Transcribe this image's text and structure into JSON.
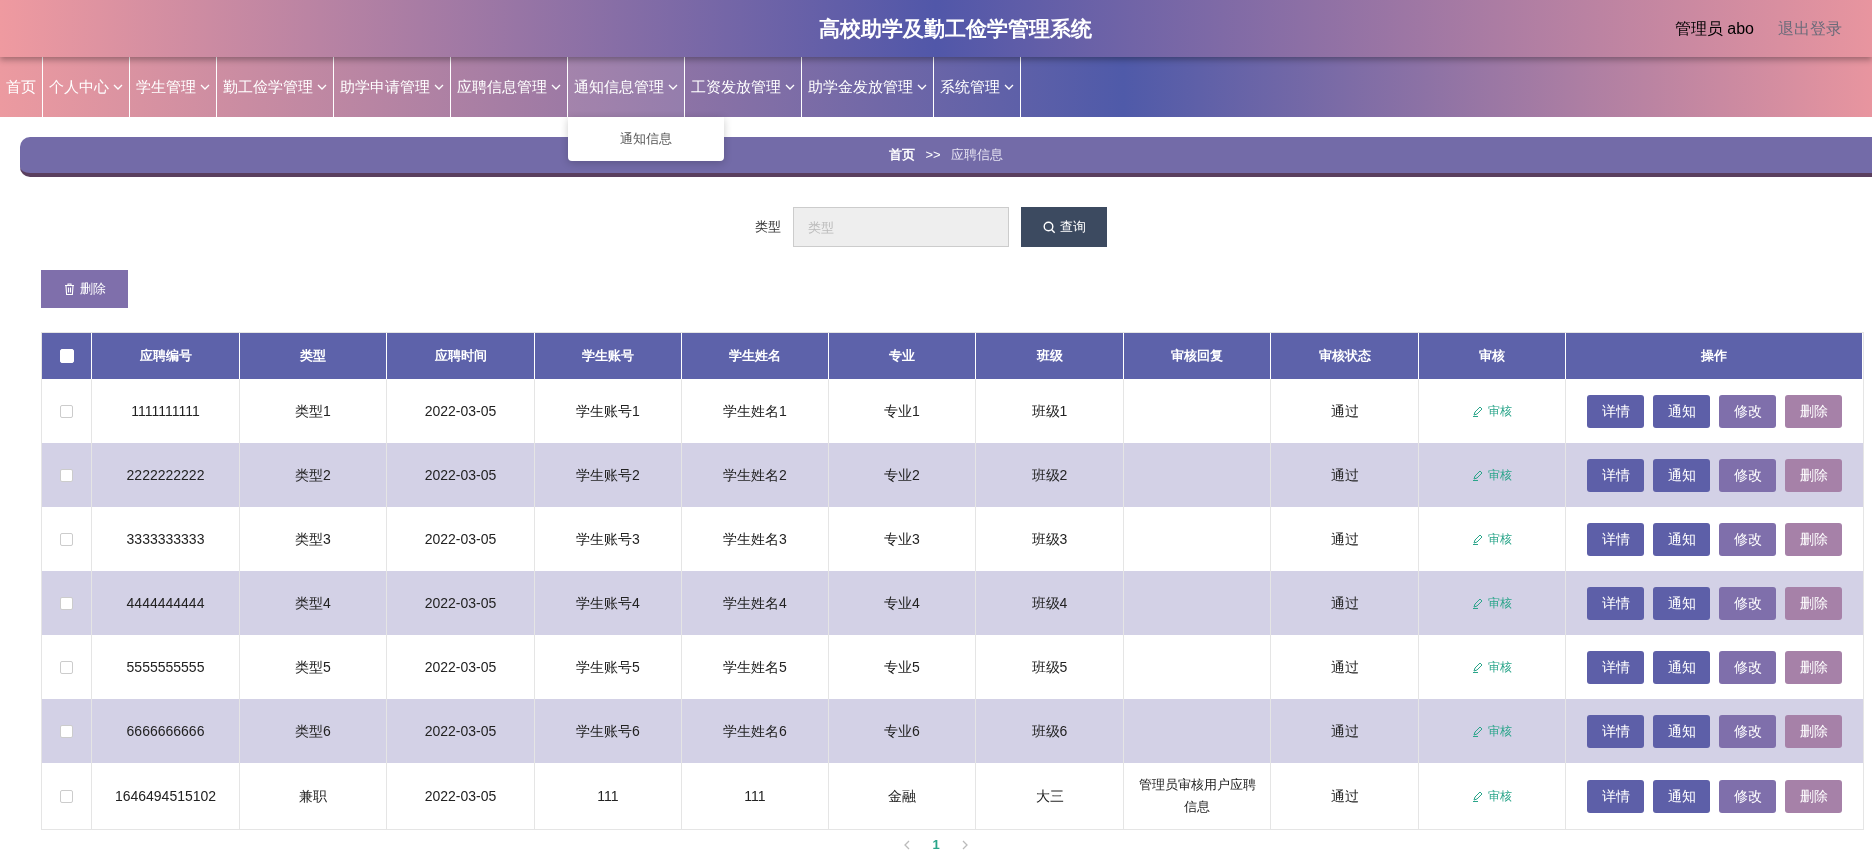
{
  "header": {
    "title": "高校助学及勤工俭学管理系统",
    "user_label": "管理员 abo",
    "logout": "退出登录"
  },
  "nav": [
    {
      "label": "首页",
      "caret": false,
      "expanded": false
    },
    {
      "label": "个人中心",
      "caret": true,
      "expanded": false
    },
    {
      "label": "学生管理",
      "caret": true,
      "expanded": false
    },
    {
      "label": "勤工俭学管理",
      "caret": true,
      "expanded": false
    },
    {
      "label": "助学申请管理",
      "caret": true,
      "expanded": false
    },
    {
      "label": "应聘信息管理",
      "caret": true,
      "expanded": false
    },
    {
      "label": "通知信息管理",
      "caret": true,
      "expanded": true,
      "dropdown": [
        "通知信息"
      ]
    },
    {
      "label": "工资发放管理",
      "caret": true,
      "expanded": false
    },
    {
      "label": "助学金发放管理",
      "caret": true,
      "expanded": false
    },
    {
      "label": "系统管理",
      "caret": true,
      "expanded": false
    }
  ],
  "breadcrumb": {
    "home": "首页",
    "separator": ">>",
    "current": "应聘信息"
  },
  "search": {
    "label": "类型",
    "placeholder": "类型",
    "button": "查询"
  },
  "delete_button": "删除",
  "table": {
    "select_all": {
      "checked": false
    },
    "columns": [
      "应聘编号",
      "类型",
      "应聘时间",
      "学生账号",
      "学生姓名",
      "专业",
      "班级",
      "审核回复",
      "审核状态",
      "审核",
      "操作"
    ],
    "rows": [
      {
        "selected": false,
        "cells": [
          "1111111111",
          "类型1",
          "2022-03-05",
          "学生账号1",
          "学生姓名1",
          "专业1",
          "班级1",
          "",
          "通过"
        ],
        "review": "审核",
        "actions": [
          {
            "label": "详情",
            "kind": "primary"
          },
          {
            "label": "通知",
            "kind": "primary"
          },
          {
            "label": "修改",
            "kind": "edit"
          },
          {
            "label": "删除",
            "kind": "danger"
          }
        ]
      },
      {
        "selected": false,
        "cells": [
          "2222222222",
          "类型2",
          "2022-03-05",
          "学生账号2",
          "学生姓名2",
          "专业2",
          "班级2",
          "",
          "通过"
        ],
        "review": "审核",
        "actions": [
          {
            "label": "详情",
            "kind": "primary"
          },
          {
            "label": "通知",
            "kind": "primary"
          },
          {
            "label": "修改",
            "kind": "edit"
          },
          {
            "label": "删除",
            "kind": "danger"
          }
        ]
      },
      {
        "selected": false,
        "cells": [
          "3333333333",
          "类型3",
          "2022-03-05",
          "学生账号3",
          "学生姓名3",
          "专业3",
          "班级3",
          "",
          "通过"
        ],
        "review": "审核",
        "actions": [
          {
            "label": "详情",
            "kind": "primary"
          },
          {
            "label": "通知",
            "kind": "primary"
          },
          {
            "label": "修改",
            "kind": "edit"
          },
          {
            "label": "删除",
            "kind": "danger"
          }
        ]
      },
      {
        "selected": false,
        "cells": [
          "4444444444",
          "类型4",
          "2022-03-05",
          "学生账号4",
          "学生姓名4",
          "专业4",
          "班级4",
          "",
          "通过"
        ],
        "review": "审核",
        "actions": [
          {
            "label": "详情",
            "kind": "primary"
          },
          {
            "label": "通知",
            "kind": "primary"
          },
          {
            "label": "修改",
            "kind": "edit"
          },
          {
            "label": "删除",
            "kind": "danger"
          }
        ]
      },
      {
        "selected": false,
        "cells": [
          "5555555555",
          "类型5",
          "2022-03-05",
          "学生账号5",
          "学生姓名5",
          "专业5",
          "班级5",
          "",
          "通过"
        ],
        "review": "审核",
        "actions": [
          {
            "label": "详情",
            "kind": "primary"
          },
          {
            "label": "通知",
            "kind": "primary"
          },
          {
            "label": "修改",
            "kind": "edit"
          },
          {
            "label": "删除",
            "kind": "danger"
          }
        ]
      },
      {
        "selected": false,
        "cells": [
          "6666666666",
          "类型6",
          "2022-03-05",
          "学生账号6",
          "学生姓名6",
          "专业6",
          "班级6",
          "",
          "通过"
        ],
        "review": "审核",
        "actions": [
          {
            "label": "详情",
            "kind": "primary"
          },
          {
            "label": "通知",
            "kind": "primary"
          },
          {
            "label": "修改",
            "kind": "edit"
          },
          {
            "label": "删除",
            "kind": "danger"
          }
        ]
      },
      {
        "selected": false,
        "cells": [
          "1646494515102",
          "兼职",
          "2022-03-05",
          "111",
          "111",
          "金融",
          "大三",
          "管理员审核用户应聘信息",
          "通过"
        ],
        "review": "审核",
        "actions": [
          {
            "label": "详情",
            "kind": "primary"
          },
          {
            "label": "通知",
            "kind": "primary"
          },
          {
            "label": "修改",
            "kind": "edit"
          },
          {
            "label": "删除",
            "kind": "danger"
          }
        ]
      }
    ]
  },
  "pagination": {
    "pages": [
      {
        "label": "1",
        "selected": true
      }
    ]
  }
}
